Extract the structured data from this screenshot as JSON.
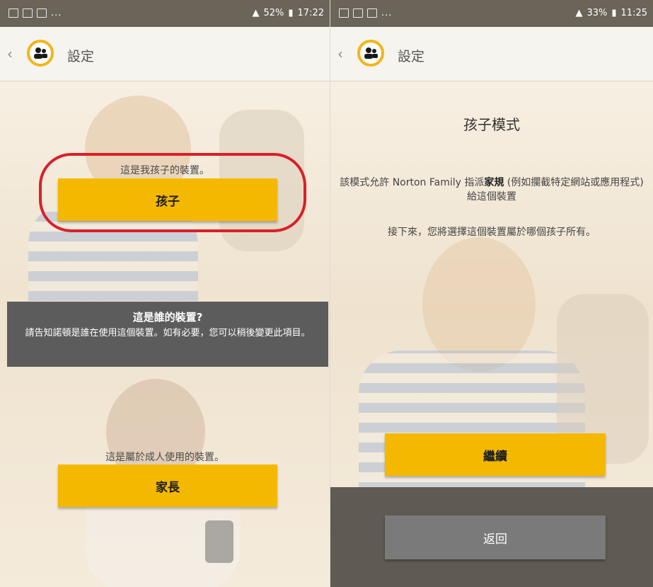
{
  "left": {
    "status": {
      "time": "17:22",
      "battery": "52%",
      "dots": "..."
    },
    "appbar": {
      "title": "設定"
    },
    "child_prompt": "這是我孩子的裝置。",
    "child_button": "孩子",
    "info": {
      "heading": "這是誰的裝置?",
      "body": "請告知諾頓是誰在使用這個裝置。如有必要，您可以稍後變更此項目。"
    },
    "adult_prompt": "這是屬於成人使用的裝置。",
    "parent_button": "家長"
  },
  "right": {
    "status": {
      "time": "11:25",
      "battery": "33%",
      "dots": "..."
    },
    "appbar": {
      "title": "設定"
    },
    "mode_title": "孩子模式",
    "desc_prefix": "該模式允許 Norton Family 指派",
    "desc_bold": "家規",
    "desc_suffix": " (例如攔截特定網站或應用程式) 給這個裝置",
    "next_text": "接下來，您將選擇這個裝置屬於哪個孩子所有。",
    "continue_button": "繼續",
    "back_button": "返回"
  },
  "colors": {
    "accent": "#f5b800",
    "highlight_ring": "#d8202a",
    "status_bar": "#6a6459",
    "info_box": "#5c5c5c"
  },
  "icons": [
    "back-chevron-icon",
    "norton-family-logo-icon",
    "notification-icon",
    "battery-icon"
  ]
}
